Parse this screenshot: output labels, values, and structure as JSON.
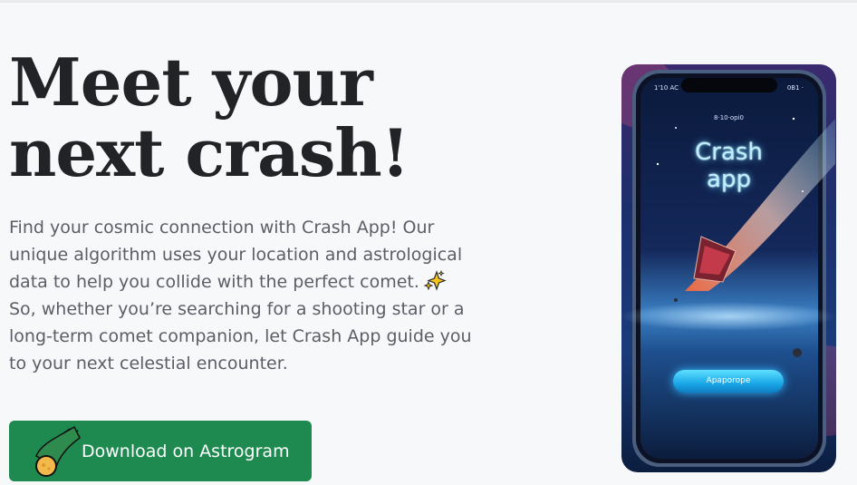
{
  "hero": {
    "title_lines": [
      "Meet your",
      "next crash!"
    ],
    "description_lines": [
      "Find your cosmic connection with Crash App! Our",
      "unique algorithm uses your location and astrological",
      "data to help you collide with the perfect comet.",
      "So, whether you’re searching for a shooting star or a",
      "long-term comet companion, let Crash App guide you",
      "to your next celestial encounter."
    ]
  },
  "cta": {
    "label": "Download on Astrogram",
    "icon": "comet-icon",
    "color": "#1e8a50"
  },
  "promo": {
    "phone_status_left": "1'10 AC",
    "phone_status_right": "0B1 ·",
    "phone_time": "8·10·opi0",
    "app_title_lines": [
      "Crash",
      "app"
    ],
    "phone_button_label": "Apaporope"
  },
  "colors": {
    "background": "#f7f8fa",
    "title": "#212327",
    "body_text": "#5b5e66",
    "accent": "#1e8a50"
  }
}
